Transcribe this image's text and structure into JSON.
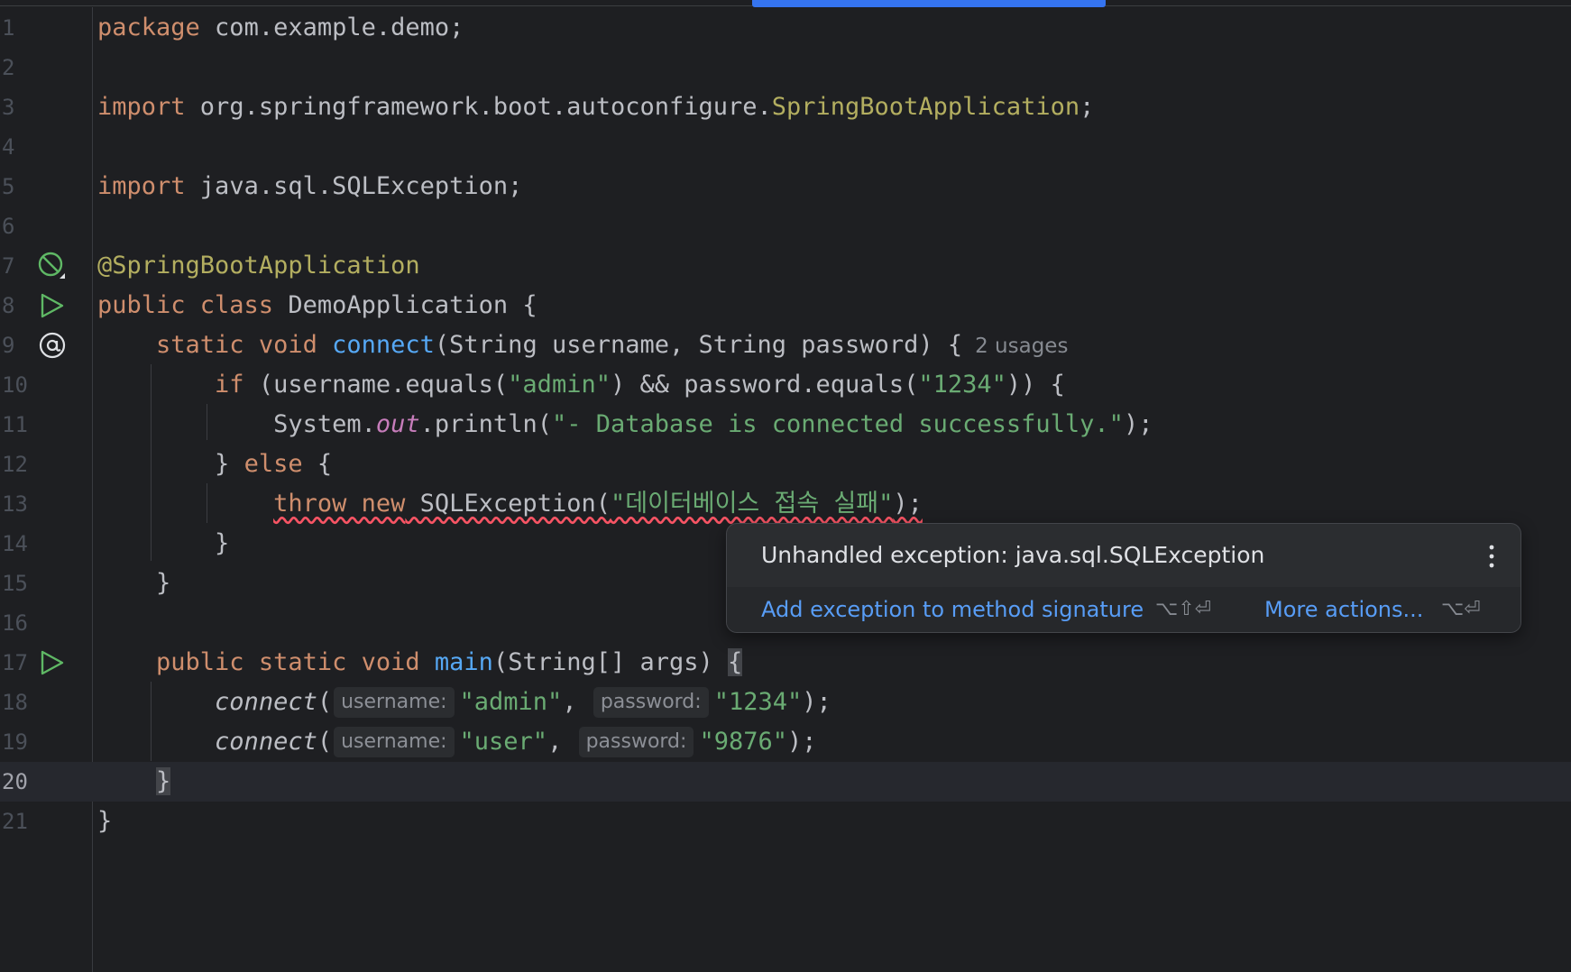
{
  "gutter": {
    "line_numbers": [
      "1",
      "2",
      "3",
      "4",
      "5",
      "6",
      "7",
      "8",
      "9",
      "10",
      "11",
      "12",
      "13",
      "14",
      "15",
      "16",
      "17",
      "18",
      "19",
      "20",
      "21"
    ],
    "current_line": "20"
  },
  "code": {
    "l1": {
      "kw": "package",
      "rest": " com.example.demo;"
    },
    "l3": {
      "kw": "import",
      "pkg": " org.springframework.boot.autoconfigure.",
      "cls": "SpringBootApplication",
      "semi": ";"
    },
    "l5": {
      "kw": "import",
      "rest": " java.sql.SQLException;"
    },
    "l7": {
      "ann": "@SpringBootApplication"
    },
    "l8": {
      "kw": "public class",
      "rest": " DemoApplication {"
    },
    "l9": {
      "indent": "    ",
      "kw": "static void",
      "sp": " ",
      "fn": "connect",
      "rest": "(String username, String password) {",
      "usages": "2 usages"
    },
    "l10": {
      "indent": "        ",
      "kw": "if",
      "p1": " (username.equals(",
      "s1": "\"admin\"",
      "p2": ") && password.equals(",
      "s2": "\"1234\"",
      "p3": ")) {"
    },
    "l11": {
      "indent": "            ",
      "p1": "System.",
      "out": "out",
      "p2": ".println(",
      "s1": "\"- Database is connected successfully.\"",
      "p3": ");"
    },
    "l12": {
      "indent": "        ",
      "p1": "} ",
      "kw": "else",
      "p2": " {"
    },
    "l13": {
      "indent": "            ",
      "kw": "throw new",
      "p1": " SQLException(",
      "s1": "\"데이터베이스 접속 실패\"",
      "p2": ");"
    },
    "l14": {
      "indent": "        ",
      "p1": "}"
    },
    "l15": {
      "indent": "    ",
      "p1": "}"
    },
    "l17": {
      "indent": "    ",
      "kw": "public static void",
      "sp": " ",
      "fn": "main",
      "rest": "(String[] args) ",
      "brace": "{"
    },
    "l18": {
      "indent": "        ",
      "call": "connect",
      "open": "(",
      "h1": "username:",
      "s1": "\"admin\"",
      "comma": ", ",
      "h2": "password:",
      "s2": "\"1234\"",
      "close": ");"
    },
    "l19": {
      "indent": "        ",
      "call": "connect",
      "open": "(",
      "h1": "username:",
      "s1": "\"user\"",
      "comma": ", ",
      "h2": "password:",
      "s2": "\"9876\"",
      "close": ");"
    },
    "l20": {
      "indent": "    ",
      "brace": "}"
    },
    "l21": {
      "p1": "}"
    }
  },
  "popup": {
    "message": "Unhandled exception: java.sql.SQLException",
    "action_primary": "Add exception to method signature",
    "action_primary_shortcut": "⌥⇧⏎",
    "action_more": "More actions...",
    "action_more_shortcut": "⌥⏎",
    "more_icon": "vertical-ellipsis-icon"
  },
  "colors": {
    "background": "#1e1f22",
    "keyword": "#cf8e6d",
    "annotation": "#b3ae60",
    "string": "#6aab73",
    "function": "#56a8f5",
    "static_field": "#c77dbb",
    "link": "#589df6",
    "error_underline": "#f75464",
    "run_icon": "#5fb865",
    "accent": "#3574f0"
  },
  "gutter_icons": {
    "line7": "spring-bean-icon",
    "line8": "run-icon",
    "line9": "at-sign-icon",
    "line17": "run-icon"
  }
}
